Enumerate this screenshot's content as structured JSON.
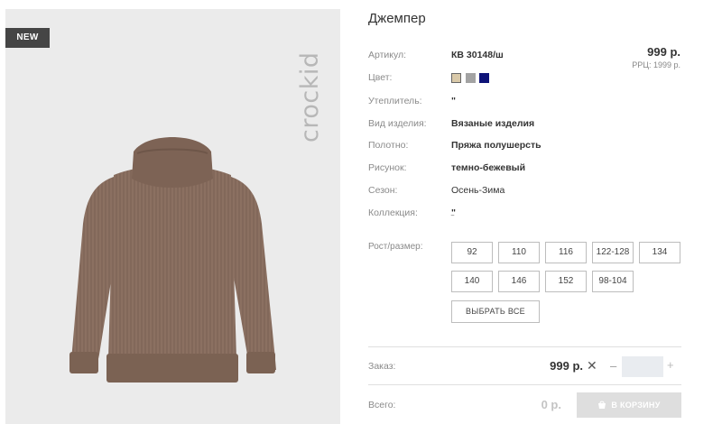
{
  "image": {
    "badge": "NEW",
    "brand": "crockid"
  },
  "product": {
    "title": "Джемпер",
    "price": "999 р.",
    "rrp": "РРЦ: 1999 р."
  },
  "specs": [
    {
      "label": "Артикул:",
      "value": "КВ 30148/ш"
    },
    {
      "label": "Цвет:",
      "value": ""
    },
    {
      "label": "Утеплитель:",
      "value": "\""
    },
    {
      "label": "Вид изделия:",
      "value": "Вязаные изделия"
    },
    {
      "label": "Полотно:",
      "value": "Пряжа полушерсть"
    },
    {
      "label": "Рисунок:",
      "value": "темно-бежевый"
    },
    {
      "label": "Сезон:",
      "value": "Осень-Зима"
    },
    {
      "label": "Коллекция:",
      "value": "\""
    }
  ],
  "colors": [
    "#d9c9a9",
    "#a3a3a3",
    "#0e1378"
  ],
  "sizes": {
    "label": "Рост/размер:",
    "options": [
      "92",
      "110",
      "116",
      "122-128",
      "134",
      "140",
      "146",
      "152",
      "98-104"
    ],
    "select_all": "ВЫБРАТЬ ВСЕ"
  },
  "order": {
    "label": "Заказ:",
    "price": "999 р.",
    "remove": "✕",
    "minus": "–",
    "plus": "+",
    "quantity": ""
  },
  "total": {
    "label": "Всего:",
    "price": "0 р.",
    "cart_button": "В КОРЗИНУ"
  }
}
